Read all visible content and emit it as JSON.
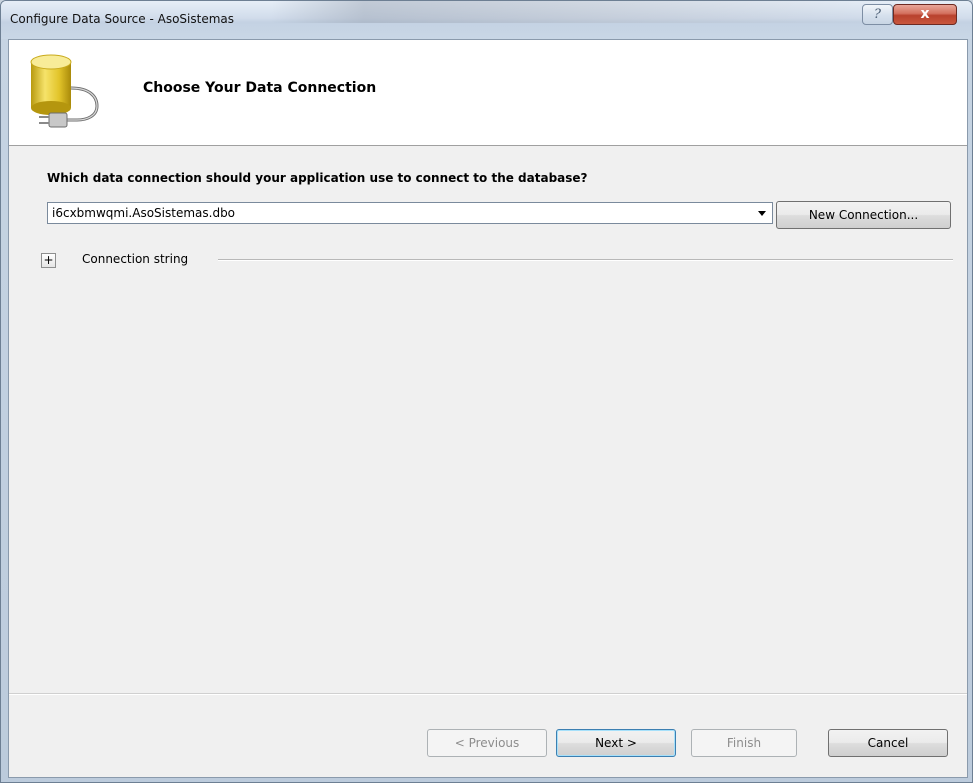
{
  "window": {
    "title": "Configure Data Source - AsoSistemas",
    "help_label": "?",
    "close_label": "x"
  },
  "header": {
    "title": "Choose Your Data Connection",
    "icon": "database-plug-icon"
  },
  "main": {
    "question": "Which data connection should your application use to connect to the database?",
    "connection_selected": "i6cxbmwqmi.AsoSistemas.dbo",
    "new_connection_label": "New Connection...",
    "expander_label": "+",
    "connection_string_label": "Connection string"
  },
  "footer": {
    "previous_label": "< Previous",
    "next_label": "Next >",
    "finish_label": "Finish",
    "cancel_label": "Cancel"
  },
  "colors": {
    "accent": "#3c7fb1",
    "db_icon": "#e8d23c",
    "close_button": "#c9573d"
  }
}
